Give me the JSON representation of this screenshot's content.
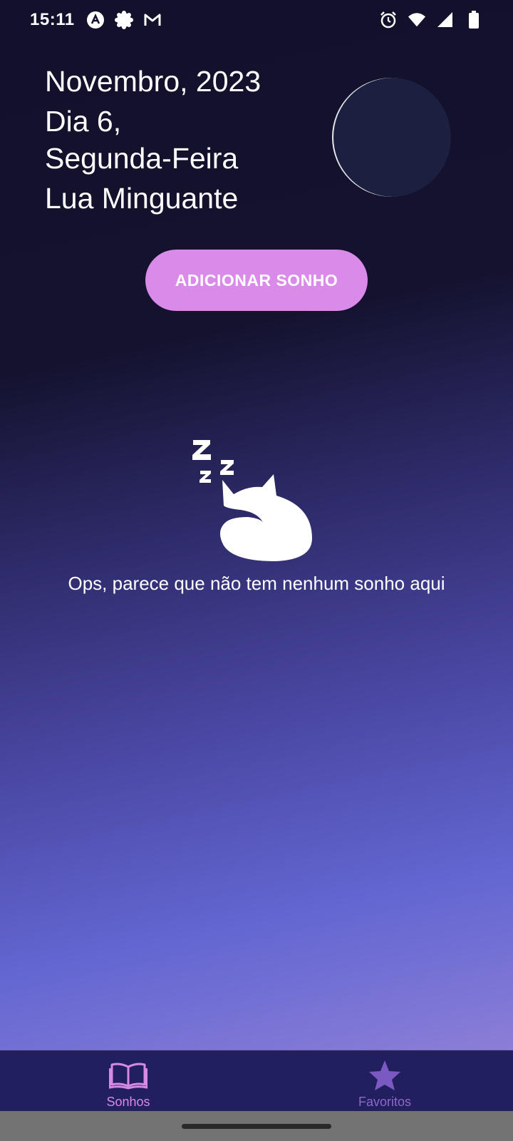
{
  "status_bar": {
    "time": "15:11",
    "left_icons": [
      "app-notification-icon",
      "settings-notification-icon",
      "gmail-icon"
    ],
    "right_icons": [
      "alarm-icon",
      "wifi-icon",
      "signal-icon",
      "battery-icon"
    ]
  },
  "header": {
    "month_year": "Novembro, 2023",
    "day": "Dia 6,",
    "weekday": "Segunda-Feira",
    "moon_phase": "Lua Minguante"
  },
  "actions": {
    "add_dream_label": "ADICIONAR SONHO"
  },
  "empty_state": {
    "message": "Ops, parece que não tem nenhum sonho aqui"
  },
  "bottom_nav": {
    "items": [
      {
        "label": "Sonhos",
        "icon": "book-icon",
        "active": true
      },
      {
        "label": "Favoritos",
        "icon": "star-icon",
        "active": false
      }
    ]
  },
  "colors": {
    "accent": "#da8ae8",
    "nav_background": "#221f5e",
    "moon": "#1b1f40"
  }
}
